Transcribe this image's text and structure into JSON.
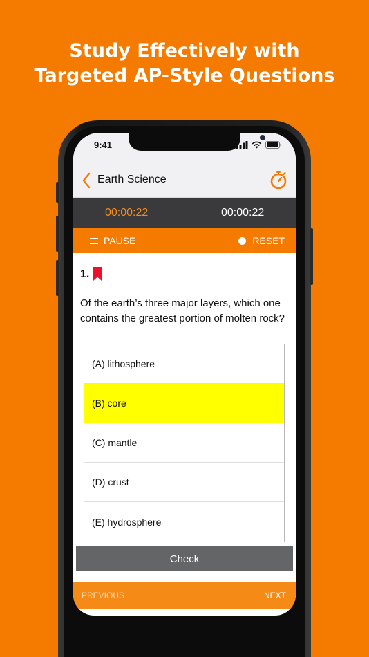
{
  "headline": {
    "line1": "Study Effectively with",
    "line2": "Targeted AP-Style Questions"
  },
  "status_bar": {
    "time": "9:41",
    "icons": [
      "signal-icon",
      "wifi-icon",
      "battery-icon"
    ]
  },
  "nav": {
    "back_icon": "chevron-left-icon",
    "title": "Earth Science",
    "timer_icon": "stopwatch-icon"
  },
  "timers": {
    "question_time": "00:00:22",
    "total_time": "00:00:22"
  },
  "controls": {
    "pause_label": "PAUSE",
    "reset_label": "RESET"
  },
  "question": {
    "number": "1.",
    "text": "Of the earth’s three major layers, which one contains the greatest portion of molten rock?",
    "bookmark_icon": "bookmark-icon"
  },
  "options": [
    {
      "label": "(A) lithosphere",
      "selected": false
    },
    {
      "label": "(B) core",
      "selected": true
    },
    {
      "label": "(C) mantle",
      "selected": false
    },
    {
      "label": "(D) crust",
      "selected": false
    },
    {
      "label": "(E) hydrosphere",
      "selected": false
    }
  ],
  "check_label": "Check",
  "footer": {
    "previous_label": "PREVIOUS",
    "next_label": "NEXT"
  },
  "colors": {
    "brand_orange": "#f57a00",
    "selected_answer": "#ffff00",
    "timer_accent": "#f38a1b",
    "bookmark_red": "#e8132b"
  }
}
